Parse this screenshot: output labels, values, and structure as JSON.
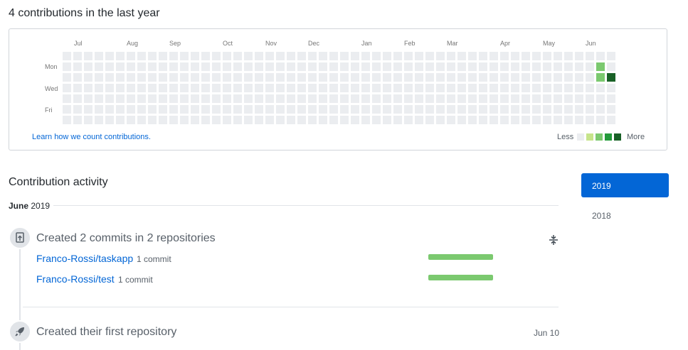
{
  "summary": "4 contributions in the last year",
  "graph": {
    "months": [
      "Jul",
      "Aug",
      "Sep",
      "Oct",
      "Nov",
      "Dec",
      "Jan",
      "Feb",
      "Mar",
      "Apr",
      "May",
      "Jun"
    ],
    "day_labels": [
      "Mon",
      "Wed",
      "Fri"
    ],
    "contributions": [
      {
        "week": 50,
        "day": 1,
        "level": 2
      },
      {
        "week": 50,
        "day": 2,
        "level": 2
      },
      {
        "week": 51,
        "day": 2,
        "level": 4
      }
    ],
    "learn_link": "Learn how we count contributions.",
    "legend_less": "Less",
    "legend_more": "More",
    "legend_colors": [
      "#ebedf0",
      "#c6e48b",
      "#7bc96f",
      "#239a3b",
      "#196127"
    ]
  },
  "activity": {
    "title": "Contribution activity",
    "month": "June",
    "year": "2019",
    "commits_event": {
      "title": "Created 2 commits in 2 repositories",
      "repos": [
        {
          "name": "Franco-Rossi/taskapp",
          "count": "1 commit"
        },
        {
          "name": "Franco-Rossi/test",
          "count": "1 commit"
        }
      ]
    },
    "repo_event": {
      "title": "Created their first repository",
      "date": "Jun 10"
    }
  },
  "years": [
    "2019",
    "2018"
  ],
  "icons": {
    "commits": "repo-push-icon",
    "repo": "rocket-icon",
    "collapse": "fold-icon"
  }
}
